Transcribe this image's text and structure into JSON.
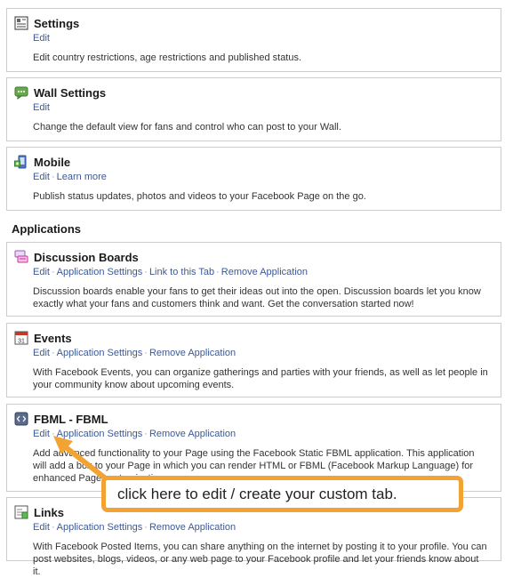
{
  "settings": {
    "title": "Settings",
    "links": [
      "Edit"
    ],
    "desc": "Edit country restrictions, age restrictions and published status.",
    "icon": "settings-icon"
  },
  "wall": {
    "title": "Wall Settings",
    "links": [
      "Edit"
    ],
    "desc": "Change the default view for fans and control who can post to your Wall.",
    "icon": "wall-icon"
  },
  "mobile": {
    "title": "Mobile",
    "links": [
      "Edit",
      "Learn more"
    ],
    "desc": "Publish status updates, photos and videos to your Facebook Page on the go.",
    "icon": "mobile-icon"
  },
  "applications_heading": "Applications",
  "discussion": {
    "title": "Discussion Boards",
    "links": [
      "Edit",
      "Application Settings",
      "Link to this Tab",
      "Remove Application"
    ],
    "desc": "Discussion boards enable your fans to get their ideas out into the open. Discussion boards let you know exactly what your fans and customers think and want. Get the conversation started now!",
    "icon": "discussion-icon"
  },
  "events": {
    "title": "Events",
    "links": [
      "Edit",
      "Application Settings",
      "Remove Application"
    ],
    "desc": "With Facebook Events, you can organize gatherings and parties with your friends, as well as let people in your community know about upcoming events.",
    "icon": "calendar-icon",
    "icon_text": "31"
  },
  "fbml": {
    "title": "FBML - FBML",
    "links": [
      "Edit",
      "Application Settings",
      "Remove Application"
    ],
    "desc": "Add advanced functionality to your Page using the Facebook Static FBML application. This application will add a box to your Page in which you can render HTML or FBML (Facebook Markup Language) for enhanced Page customization.",
    "icon": "fbml-icon"
  },
  "links_app": {
    "title": "Links",
    "links": [
      "Edit",
      "Application Settings",
      "Remove Application"
    ],
    "desc": "With Facebook Posted Items, you can share anything on the internet by posting it to your profile. You can post websites, blogs, videos, or any web page to your Facebook profile and let your friends know about it.",
    "icon": "link-icon"
  },
  "callout": {
    "text": "click here to edit / create your custom tab."
  },
  "colors": {
    "link": "#3b5998",
    "border": "#cccccc",
    "callout": "#f2a333"
  }
}
